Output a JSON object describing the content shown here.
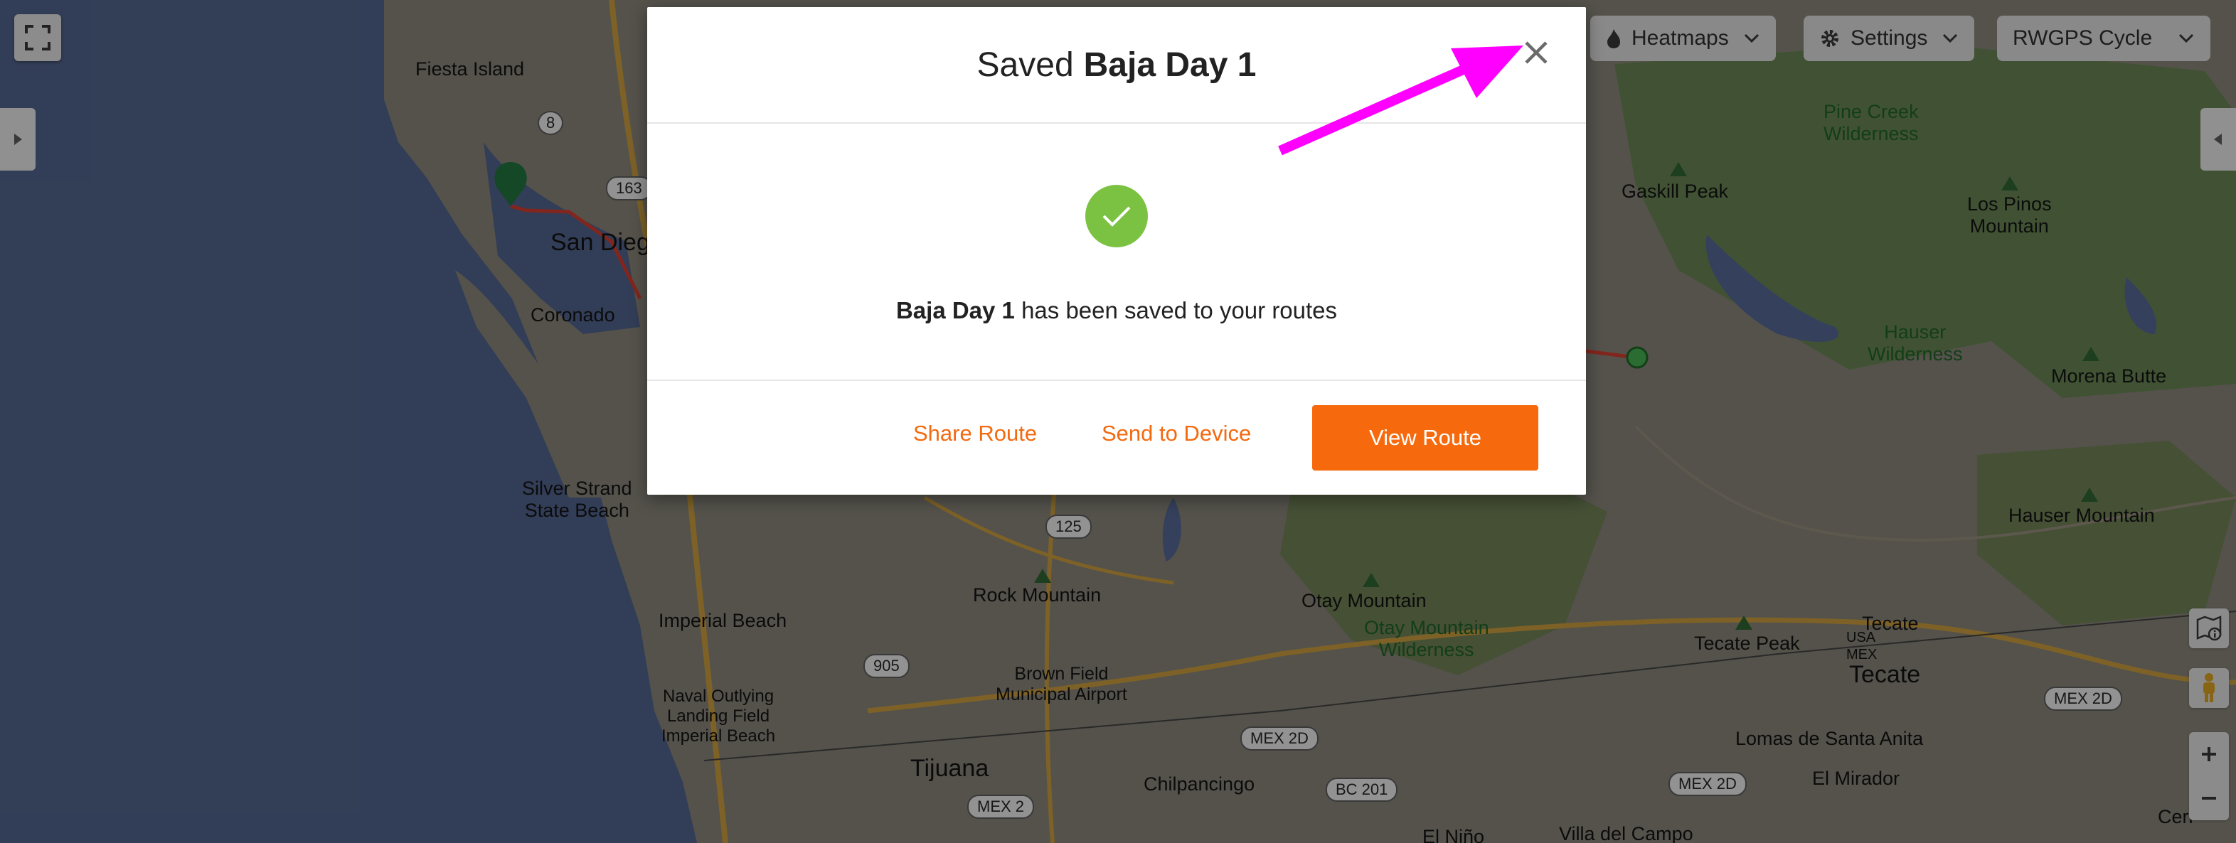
{
  "map": {
    "labels": {
      "fiesta_island": "Fiesta Island",
      "san_diego": "San Dieg",
      "coronado": "Coronado",
      "silver_strand": "Silver Strand\nState Beach",
      "imperial_beach": "Imperial Beach",
      "naval_outlying": "Naval Outlying\nLanding Field\nImperial Beach",
      "tijuana": "Tijuana",
      "rock_mountain": "Rock Mountain",
      "brown_field": "Brown Field\nMunicipal Airport",
      "chilpancingo": "Chilpancingo",
      "otay_mountain": "Otay Mountain",
      "otay_wilderness": "Otay Mountain\nWilderness",
      "gaskill_peak": "Gaskill Peak",
      "pine_creek": "Pine Creek\nWilderness",
      "los_pinos": "Los Pinos\nMountain",
      "hauser_wilderness": "Hauser\nWilderness",
      "morena_butte": "Morena Butte",
      "hauser_mountain": "Hauser Mountain",
      "tecate_peak": "Tecate Peak",
      "tecate_small": "Tecate",
      "tecate_big": "Tecate",
      "usa": "USA",
      "mex": "MEX",
      "lomas": "Lomas de Santa Anita",
      "el_mirador": "El Mirador",
      "cerro": "Cerr",
      "villa_campo": "Villa del Campo",
      "el_nino": "El Niño"
    },
    "shields": {
      "r8": "8",
      "r163": "163",
      "r125": "125",
      "r905": "905",
      "mex2d_a": "MEX 2D",
      "mex2d_b": "MEX 2D",
      "mex2d_c": "MEX 2D",
      "mex2": "MEX 2",
      "bc201": "BC 201"
    }
  },
  "controls": {
    "heatmaps_label": "Heatmaps",
    "settings_label": "Settings",
    "map_style_label": "RWGPS Cycle"
  },
  "modal": {
    "title_prefix": "Saved",
    "route_name": "Baja Day 1",
    "message_suffix": "has been saved to your routes",
    "share_label": "Share Route",
    "send_label": "Send to Device",
    "view_label": "View Route"
  },
  "colors": {
    "accent_orange": "#f66a0d",
    "success_green": "#7cc242",
    "annotation_arrow": "#ff00ff",
    "water": "#4b5b80",
    "route_red": "#c0392b"
  }
}
